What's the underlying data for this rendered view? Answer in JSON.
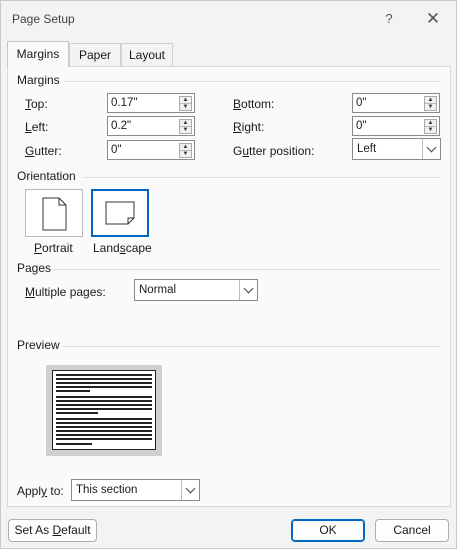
{
  "window": {
    "title": "Page Setup",
    "help_label": "?",
    "close_label": "✕"
  },
  "tabs": [
    {
      "label": "Margins",
      "active": true
    },
    {
      "label": "Paper",
      "active": false
    },
    {
      "label": "Layout",
      "active": false
    }
  ],
  "margins": {
    "heading": "Margins",
    "top": {
      "label_key": "T",
      "label_rest": "op:",
      "value": "0.17\""
    },
    "left": {
      "label_key": "L",
      "label_rest": "eft:",
      "value": "0.2\""
    },
    "gutter": {
      "label_key": "G",
      "label_rest": "utter:",
      "value": "0\""
    },
    "bottom": {
      "label_key": "B",
      "label_rest": "ottom:",
      "value": "0\""
    },
    "right": {
      "label_key": "R",
      "label_rest": "ight:",
      "value": "0\""
    },
    "gutter_position": {
      "label_pre": "G",
      "label_key": "u",
      "label_rest": "tter position:",
      "value": "Left"
    }
  },
  "orientation": {
    "heading": "Orientation",
    "portrait": {
      "label_key": "P",
      "label_rest": "ortrait",
      "selected": false
    },
    "landscape": {
      "label_pre": "Land",
      "label_key": "s",
      "label_rest": "cape",
      "selected": true
    }
  },
  "pages": {
    "heading": "Pages",
    "multiple_pages": {
      "label_key": "M",
      "label_rest": "ultiple pages:",
      "value": "Normal"
    }
  },
  "preview": {
    "heading": "Preview"
  },
  "apply_to": {
    "label_pre": "Appl",
    "label_key": "y",
    "label_rest": " to:",
    "value": "This section"
  },
  "buttons": {
    "set_default_pre": "Set As ",
    "set_default_key": "D",
    "set_default_rest": "efault",
    "ok": "OK",
    "cancel": "Cancel"
  },
  "colors": {
    "accent": "#0067c0",
    "background": "#f3f3f3"
  }
}
